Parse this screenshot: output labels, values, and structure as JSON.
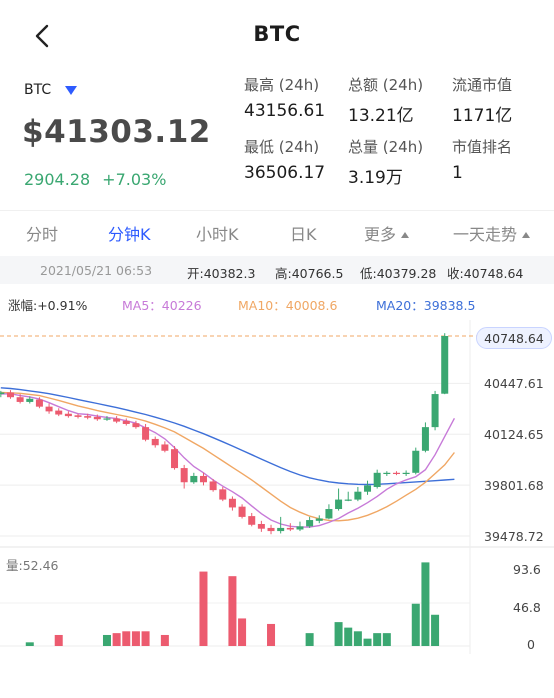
{
  "nav": {
    "title": "BTC",
    "back_icon": "chevron-left-icon"
  },
  "ticker": {
    "symbol": "BTC",
    "dropdown_icon": "triangle-down-icon",
    "price": "$41303.12",
    "change_abs": "2904.28",
    "change_pct": "+7.03%"
  },
  "stats": [
    {
      "label": "最高 (24h)",
      "value": "43156.61"
    },
    {
      "label": "总额 (24h)",
      "value": "13.21亿"
    },
    {
      "label": "流通市值",
      "value": "1171亿"
    },
    {
      "label": "最低 (24h)",
      "value": "36506.17"
    },
    {
      "label": "总量 (24h)",
      "value": "3.19万"
    },
    {
      "label": "市值排名",
      "value": "1"
    }
  ],
  "tabs": [
    {
      "label": "分时",
      "active": false
    },
    {
      "label": "分钟K",
      "active": true
    },
    {
      "label": "小时K",
      "active": false
    },
    {
      "label": "日K",
      "active": false
    },
    {
      "label": "更多",
      "active": false,
      "dropdown": true
    },
    {
      "label": "一天走势",
      "active": false,
      "dropdown": true
    }
  ],
  "ohlc": {
    "date": "2021/05/21 06:53",
    "open": "开:40382.3",
    "high": "高:40766.5",
    "low": "低:40379.28",
    "close": "收:40748.64"
  },
  "ma": {
    "change": "涨幅:+0.91%",
    "ma5": "MA5：40226",
    "ma10": "MA10：40008.6",
    "ma20": "MA20：39838.5"
  },
  "colors": {
    "up": "#3aa771",
    "down": "#ec5b6f",
    "ma5": "#c77ad8",
    "ma10": "#f0a764",
    "ma20": "#3d6fd8",
    "accent": "#2e5bff"
  },
  "chart_data": {
    "type": "candlestick",
    "price_axis_labels": [
      "40748.64",
      "40447.61",
      "40124.65",
      "39801.68",
      "39478.72"
    ],
    "price_range": [
      39478.72,
      40748.64
    ],
    "last_price": 40748.64,
    "volume_label": "量:52.46",
    "volume_axis_labels": [
      "93.6",
      "46.8",
      "0"
    ],
    "volume_range": [
      0,
      93.6
    ],
    "candles": [
      {
        "o": 40380,
        "c": 40390,
        "h": 40400,
        "l": 40360
      },
      {
        "o": 40390,
        "c": 40360,
        "h": 40405,
        "l": 40350
      },
      {
        "o": 40360,
        "c": 40330,
        "h": 40380,
        "l": 40320
      },
      {
        "o": 40330,
        "c": 40350,
        "h": 40365,
        "l": 40320
      },
      {
        "o": 40345,
        "c": 40300,
        "h": 40360,
        "l": 40290
      },
      {
        "o": 40300,
        "c": 40270,
        "h": 40320,
        "l": 40255
      },
      {
        "o": 40275,
        "c": 40250,
        "h": 40290,
        "l": 40240
      },
      {
        "o": 40255,
        "c": 40240,
        "h": 40270,
        "l": 40230
      },
      {
        "o": 40245,
        "c": 40235,
        "h": 40255,
        "l": 40225
      },
      {
        "o": 40240,
        "c": 40230,
        "h": 40255,
        "l": 40220
      },
      {
        "o": 40235,
        "c": 40220,
        "h": 40250,
        "l": 40210
      },
      {
        "o": 40225,
        "c": 40225,
        "h": 40240,
        "l": 40210
      },
      {
        "o": 40225,
        "c": 40205,
        "h": 40240,
        "l": 40195
      },
      {
        "o": 40210,
        "c": 40190,
        "h": 40225,
        "l": 40180
      },
      {
        "o": 40195,
        "c": 40170,
        "h": 40210,
        "l": 40160
      },
      {
        "o": 40170,
        "c": 40090,
        "h": 40190,
        "l": 40080
      },
      {
        "o": 40095,
        "c": 40055,
        "h": 40110,
        "l": 40040
      },
      {
        "o": 40060,
        "c": 40020,
        "h": 40080,
        "l": 40010
      },
      {
        "o": 40030,
        "c": 39910,
        "h": 40050,
        "l": 39900
      },
      {
        "o": 39910,
        "c": 39820,
        "h": 39930,
        "l": 39780
      },
      {
        "o": 39820,
        "c": 39860,
        "h": 39880,
        "l": 39810
      },
      {
        "o": 39860,
        "c": 39820,
        "h": 39880,
        "l": 39800
      },
      {
        "o": 39825,
        "c": 39770,
        "h": 39840,
        "l": 39760
      },
      {
        "o": 39775,
        "c": 39710,
        "h": 39790,
        "l": 39700
      },
      {
        "o": 39715,
        "c": 39660,
        "h": 39730,
        "l": 39640
      },
      {
        "o": 39665,
        "c": 39600,
        "h": 39680,
        "l": 39590
      },
      {
        "o": 39605,
        "c": 39550,
        "h": 39625,
        "l": 39540
      },
      {
        "o": 39555,
        "c": 39525,
        "h": 39575,
        "l": 39505
      },
      {
        "o": 39530,
        "c": 39510,
        "h": 39550,
        "l": 39490
      },
      {
        "o": 39510,
        "c": 39530,
        "h": 39600,
        "l": 39495
      },
      {
        "o": 39530,
        "c": 39520,
        "h": 39560,
        "l": 39510
      },
      {
        "o": 39520,
        "c": 39540,
        "h": 39570,
        "l": 39510
      },
      {
        "o": 39540,
        "c": 39580,
        "h": 39600,
        "l": 39530
      },
      {
        "o": 39575,
        "c": 39590,
        "h": 39610,
        "l": 39560
      },
      {
        "o": 39590,
        "c": 39650,
        "h": 39680,
        "l": 39585
      },
      {
        "o": 39650,
        "c": 39710,
        "h": 39780,
        "l": 39640
      },
      {
        "o": 39710,
        "c": 39710,
        "h": 39760,
        "l": 39700
      },
      {
        "o": 39710,
        "c": 39760,
        "h": 39790,
        "l": 39700
      },
      {
        "o": 39760,
        "c": 39800,
        "h": 39830,
        "l": 39740
      },
      {
        "o": 39790,
        "c": 39880,
        "h": 39900,
        "l": 39780
      },
      {
        "o": 39875,
        "c": 39880,
        "h": 39890,
        "l": 39860
      },
      {
        "o": 39880,
        "c": 39875,
        "h": 39890,
        "l": 39865
      },
      {
        "o": 39875,
        "c": 39880,
        "h": 39895,
        "l": 39860
      },
      {
        "o": 39880,
        "c": 40020,
        "h": 40040,
        "l": 39870
      },
      {
        "o": 40020,
        "c": 40170,
        "h": 40200,
        "l": 40010
      },
      {
        "o": 40170,
        "c": 40380,
        "h": 40400,
        "l": 40150
      },
      {
        "o": 40382.3,
        "c": 40748.64,
        "h": 40766.5,
        "l": 40379.28
      }
    ],
    "volumes": [
      0,
      0,
      0,
      4,
      0,
      0,
      12,
      0,
      0,
      0,
      0,
      12,
      14,
      16,
      16,
      16,
      0,
      12,
      0,
      0,
      0,
      81,
      0,
      0,
      76,
      30,
      0,
      0,
      24,
      0,
      0,
      0,
      14,
      0,
      0,
      26,
      20,
      16,
      8,
      14,
      14,
      0,
      0,
      46,
      91,
      34,
      0,
      0
    ],
    "ma5": [
      40380,
      40382,
      40370,
      40362,
      40348,
      40325,
      40300,
      40275,
      40255,
      40250,
      40240,
      40232,
      40224,
      40210,
      40195,
      40165,
      40135,
      40095,
      40040,
      39975,
      39920,
      39880,
      39835,
      39795,
      39760,
      39720,
      39670,
      39620,
      39580,
      39555,
      39540,
      39535,
      39535,
      39545,
      39565,
      39590,
      39625,
      39655,
      39690,
      39730,
      39775,
      39810,
      39835,
      39855,
      39900,
      39995,
      40110,
      40226
    ],
    "ma10": [
      40390,
      40388,
      40385,
      40378,
      40370,
      40355,
      40340,
      40322,
      40305,
      40290,
      40275,
      40262,
      40250,
      40238,
      40225,
      40208,
      40188,
      40165,
      40140,
      40105,
      40070,
      40035,
      39995,
      39955,
      39915,
      39875,
      39835,
      39790,
      39745,
      39700,
      39660,
      39630,
      39605,
      39588,
      39578,
      39575,
      39580,
      39592,
      39610,
      39635,
      39665,
      39700,
      39738,
      39775,
      39820,
      39875,
      39930,
      40008.6
    ],
    "ma20": [
      40420,
      40415,
      40408,
      40400,
      40392,
      40382,
      40370,
      40358,
      40345,
      40332,
      40320,
      40307,
      40294,
      40280,
      40265,
      40250,
      40233,
      40215,
      40196,
      40175,
      40152,
      40128,
      40103,
      40077,
      40050,
      40022,
      39995,
      39967,
      39940,
      39913,
      39888,
      39866,
      39848,
      39834,
      39823,
      39815,
      39810,
      39807,
      39806,
      39807,
      39810,
      39814,
      39818,
      39822,
      39826,
      39830,
      39834,
      39838.5
    ]
  }
}
